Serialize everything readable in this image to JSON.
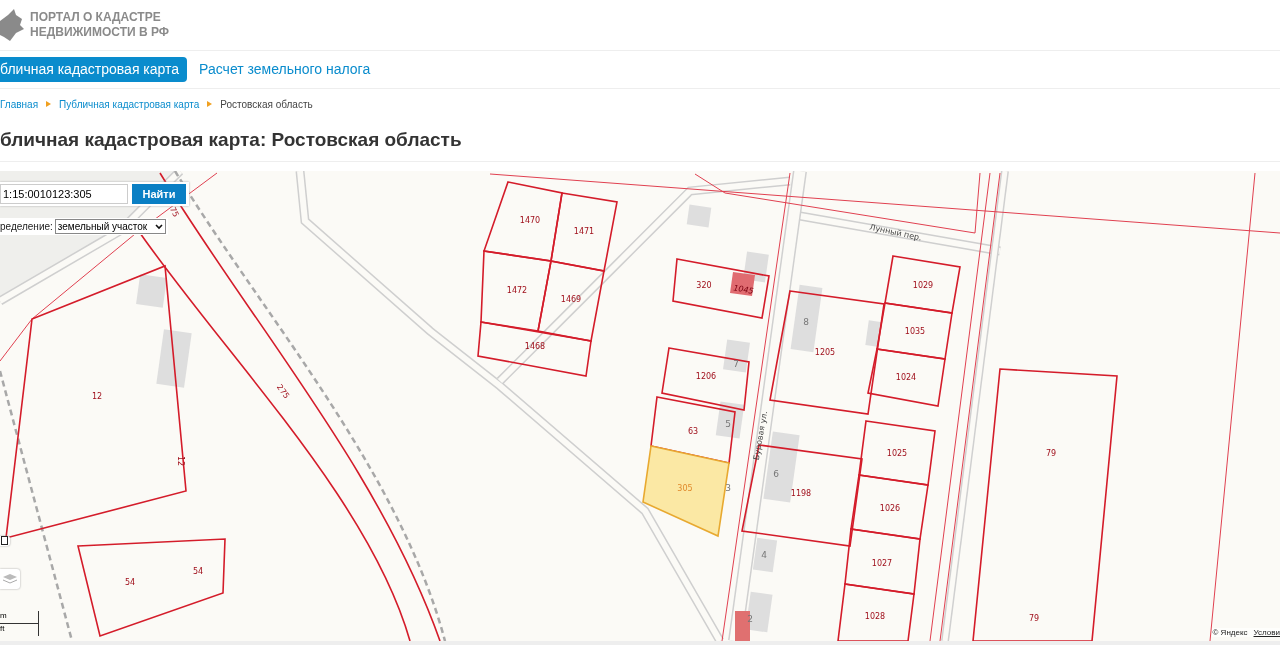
{
  "header": {
    "logo_lines": [
      "ПОРТАЛ О КАДАСТРЕ",
      "НЕДВИЖИМОСТИ В РФ"
    ]
  },
  "nav": [
    {
      "label": "бличная кадастровая карта",
      "selected": true
    },
    {
      "label": "Расчет земельного налога",
      "selected": false
    }
  ],
  "breadcrumbs": [
    {
      "label": "Главная",
      "link": true
    },
    {
      "label": "Публичная кадастровая карта",
      "link": true
    },
    {
      "label": "Ростовская область",
      "link": false
    }
  ],
  "page_title": "бличная кадастровая карта: Ростовская область",
  "map": {
    "search": {
      "value": "1:15:0010123:305",
      "button": "Найти"
    },
    "filter": {
      "label": "ределение:",
      "value": "земельный участок"
    },
    "parcels": [
      {
        "kind": "road",
        "labels": [
          "75",
          "275"
        ],
        "selected": false
      },
      {
        "kind": "lot",
        "labels": [
          "12",
          "12"
        ],
        "selected": false
      },
      {
        "kind": "lot",
        "labels": [
          "54",
          "54"
        ],
        "selected": false
      },
      {
        "kind": "lot",
        "labels": [
          "1470"
        ],
        "selected": false
      },
      {
        "kind": "lot",
        "labels": [
          "1471"
        ],
        "selected": false
      },
      {
        "kind": "lot",
        "labels": [
          "1472"
        ],
        "selected": false
      },
      {
        "kind": "lot",
        "labels": [
          "1469"
        ],
        "selected": false
      },
      {
        "kind": "lot",
        "labels": [
          "1468"
        ],
        "selected": false
      },
      {
        "kind": "building",
        "labels": [
          "1045"
        ],
        "selected": false
      },
      {
        "kind": "lot",
        "labels": [
          "320"
        ],
        "selected": false
      },
      {
        "kind": "lot",
        "labels": [
          "1206"
        ],
        "selected": false
      },
      {
        "kind": "lot",
        "labels": [
          "63"
        ],
        "selected": false
      },
      {
        "kind": "lot",
        "labels": [
          "305"
        ],
        "selected": true
      },
      {
        "kind": "lot",
        "labels": [
          "1205"
        ],
        "selected": false
      },
      {
        "kind": "lot",
        "labels": [
          "1029"
        ],
        "selected": false
      },
      {
        "kind": "lot",
        "labels": [
          "1035"
        ],
        "selected": false
      },
      {
        "kind": "lot",
        "labels": [
          "1024"
        ],
        "selected": false
      },
      {
        "kind": "lot",
        "labels": [
          "1198"
        ],
        "selected": false
      },
      {
        "kind": "lot",
        "labels": [
          "1025"
        ],
        "selected": false
      },
      {
        "kind": "lot",
        "labels": [
          "1026"
        ],
        "selected": false
      },
      {
        "kind": "lot",
        "labels": [
          "1027"
        ],
        "selected": false
      },
      {
        "kind": "lot",
        "labels": [
          "1028"
        ],
        "selected": false
      },
      {
        "kind": "lot",
        "labels": [
          "79",
          "79"
        ],
        "selected": false
      }
    ],
    "house_numbers": [
      "8",
      "7",
      "5",
      "3",
      "6",
      "4",
      "2"
    ],
    "streets": [
      "Лунный пер.",
      "Буровая ул."
    ],
    "scale_units": [
      "m",
      "ft"
    ],
    "attribution": {
      "copyright": "© Яндекс",
      "link": "Услови"
    }
  }
}
